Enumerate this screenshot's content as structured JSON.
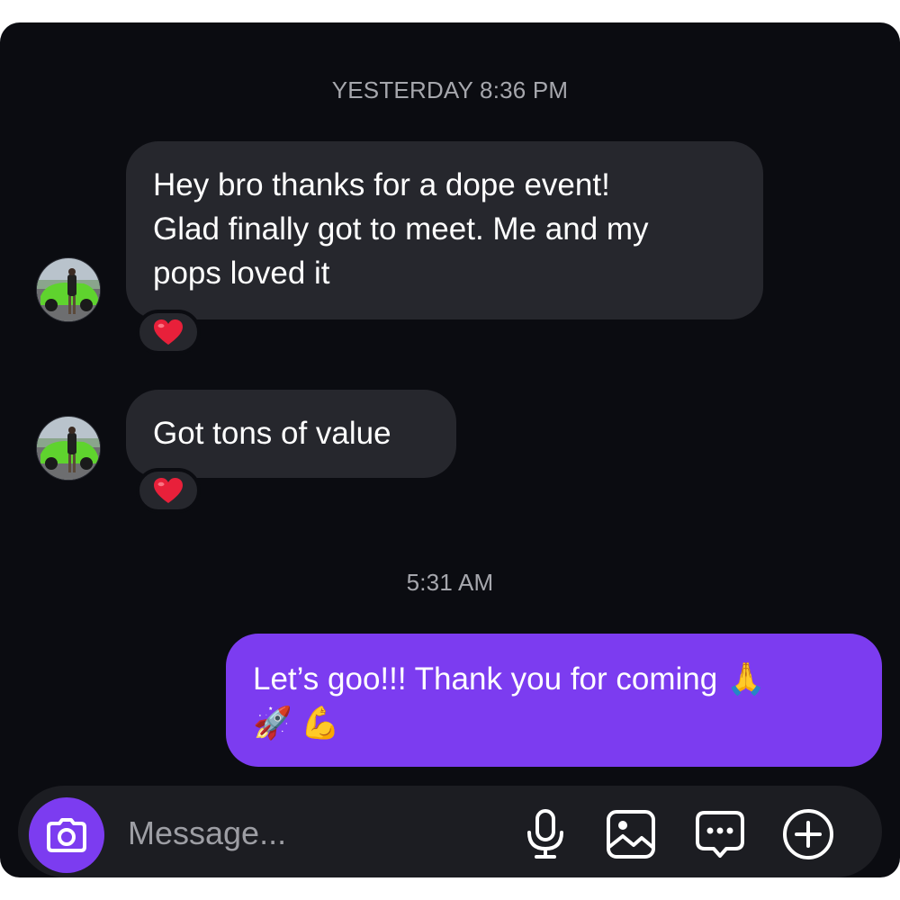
{
  "thread": {
    "timestamps": [
      "YESTERDAY 8:36 PM",
      "5:31 AM"
    ],
    "messages": [
      {
        "direction": "incoming",
        "lines": [
          "Hey bro thanks for a dope event!",
          "Glad finally got to meet. Me and my",
          "pops loved it"
        ],
        "reaction": "❤️"
      },
      {
        "direction": "incoming",
        "lines": [
          "Got tons of value"
        ],
        "reaction": "❤️"
      },
      {
        "direction": "outgoing",
        "lines": [
          "Let’s goo!!! Thank you for coming 🙏",
          "🚀 💪"
        ]
      }
    ]
  },
  "composer": {
    "placeholder": "Message...",
    "icons": [
      "camera-icon",
      "microphone-icon",
      "image-icon",
      "sticker-icon",
      "plus-icon"
    ]
  },
  "colors": {
    "background": "#0b0c11",
    "incoming_bubble": "#26272d",
    "outgoing_bubble": "#7c3cf0",
    "accent": "#7c3cf0",
    "timestamp_text": "#a6a7ad"
  }
}
